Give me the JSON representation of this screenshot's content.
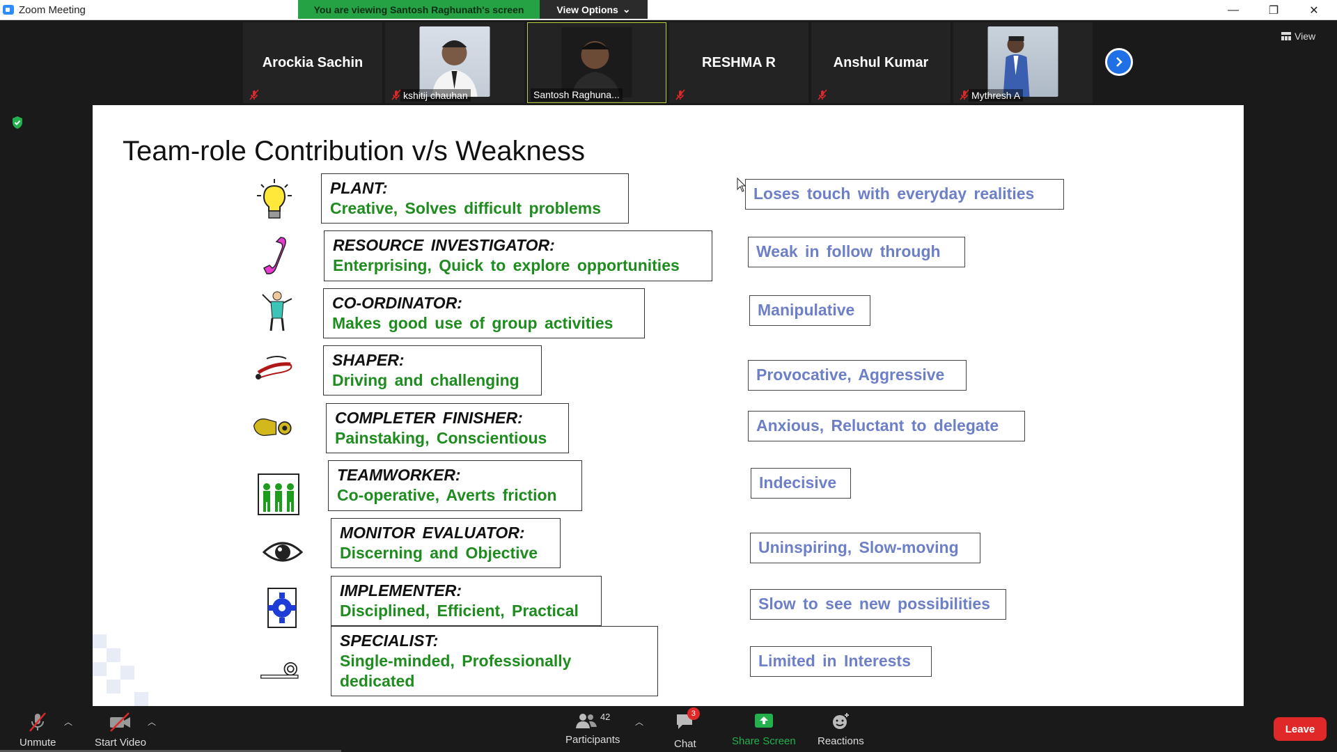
{
  "window": {
    "title": "Zoom Meeting"
  },
  "banner": {
    "viewing": "You are viewing Santosh Raghunath's screen",
    "view_options": "View Options"
  },
  "participants_strip": {
    "tiles": [
      {
        "name": "Arockia Sachin",
        "type": "name"
      },
      {
        "name": "kshitij chauhan",
        "type": "photo"
      },
      {
        "name": "Santosh Raghuna...",
        "type": "photo"
      },
      {
        "name": "RESHMA R",
        "type": "name"
      },
      {
        "name": "Anshul Kumar",
        "type": "name"
      },
      {
        "name": "Mythresh A",
        "type": "photo"
      }
    ],
    "view_label": "View"
  },
  "slide": {
    "title": "Team-role Contribution v/s Weakness",
    "roles": [
      {
        "name": "PLANT:",
        "desc": "Creative, Solves difficult problems",
        "weakness": "Loses touch with everyday realities",
        "icon": "lightbulb-icon"
      },
      {
        "name": "RESOURCE INVESTIGATOR:",
        "desc": "Enterprising, Quick to explore opportunities",
        "weakness": "Weak in follow through",
        "icon": "telephone-icon"
      },
      {
        "name": "CO-ORDINATOR:",
        "desc": "Makes good use of group activities",
        "weakness": "Manipulative",
        "icon": "conductor-icon"
      },
      {
        "name": "SHAPER:",
        "desc": "Driving and challenging",
        "weakness": "Provocative, Aggressive",
        "icon": "whip-icon"
      },
      {
        "name": "COMPLETER FINISHER:",
        "desc": "Painstaking, Conscientious",
        "weakness": "Anxious, Reluctant to delegate",
        "icon": "hand-key-icon"
      },
      {
        "name": "TEAMWORKER:",
        "desc": "Co-operative, Averts friction",
        "weakness": "Indecisive",
        "icon": "team-people-icon"
      },
      {
        "name": "MONITOR EVALUATOR:",
        "desc": "Discerning and Objective",
        "weakness": "Uninspiring, Slow-moving",
        "icon": "eye-icon"
      },
      {
        "name": "IMPLEMENTER:",
        "desc": "Disciplined, Efficient, Practical",
        "weakness": "Slow to see new possibilities",
        "icon": "gear-icon"
      },
      {
        "name": "SPECIALIST:",
        "desc": "Single-minded, Professionally dedicated",
        "weakness": "Limited in Interests",
        "icon": "tool-icon"
      }
    ]
  },
  "toolbar": {
    "unmute": "Unmute",
    "start_video": "Start Video",
    "participants": "Participants",
    "participants_count": "42",
    "chat": "Chat",
    "chat_badge": "3",
    "share_screen": "Share Screen",
    "reactions": "Reactions",
    "leave": "Leave"
  },
  "colors": {
    "banner_green": "#25a244",
    "leave_red": "#e02828",
    "desc_green": "#1e8c1e",
    "weakness_blue": "#6d7fc7",
    "active_tile": "#b5d334"
  }
}
